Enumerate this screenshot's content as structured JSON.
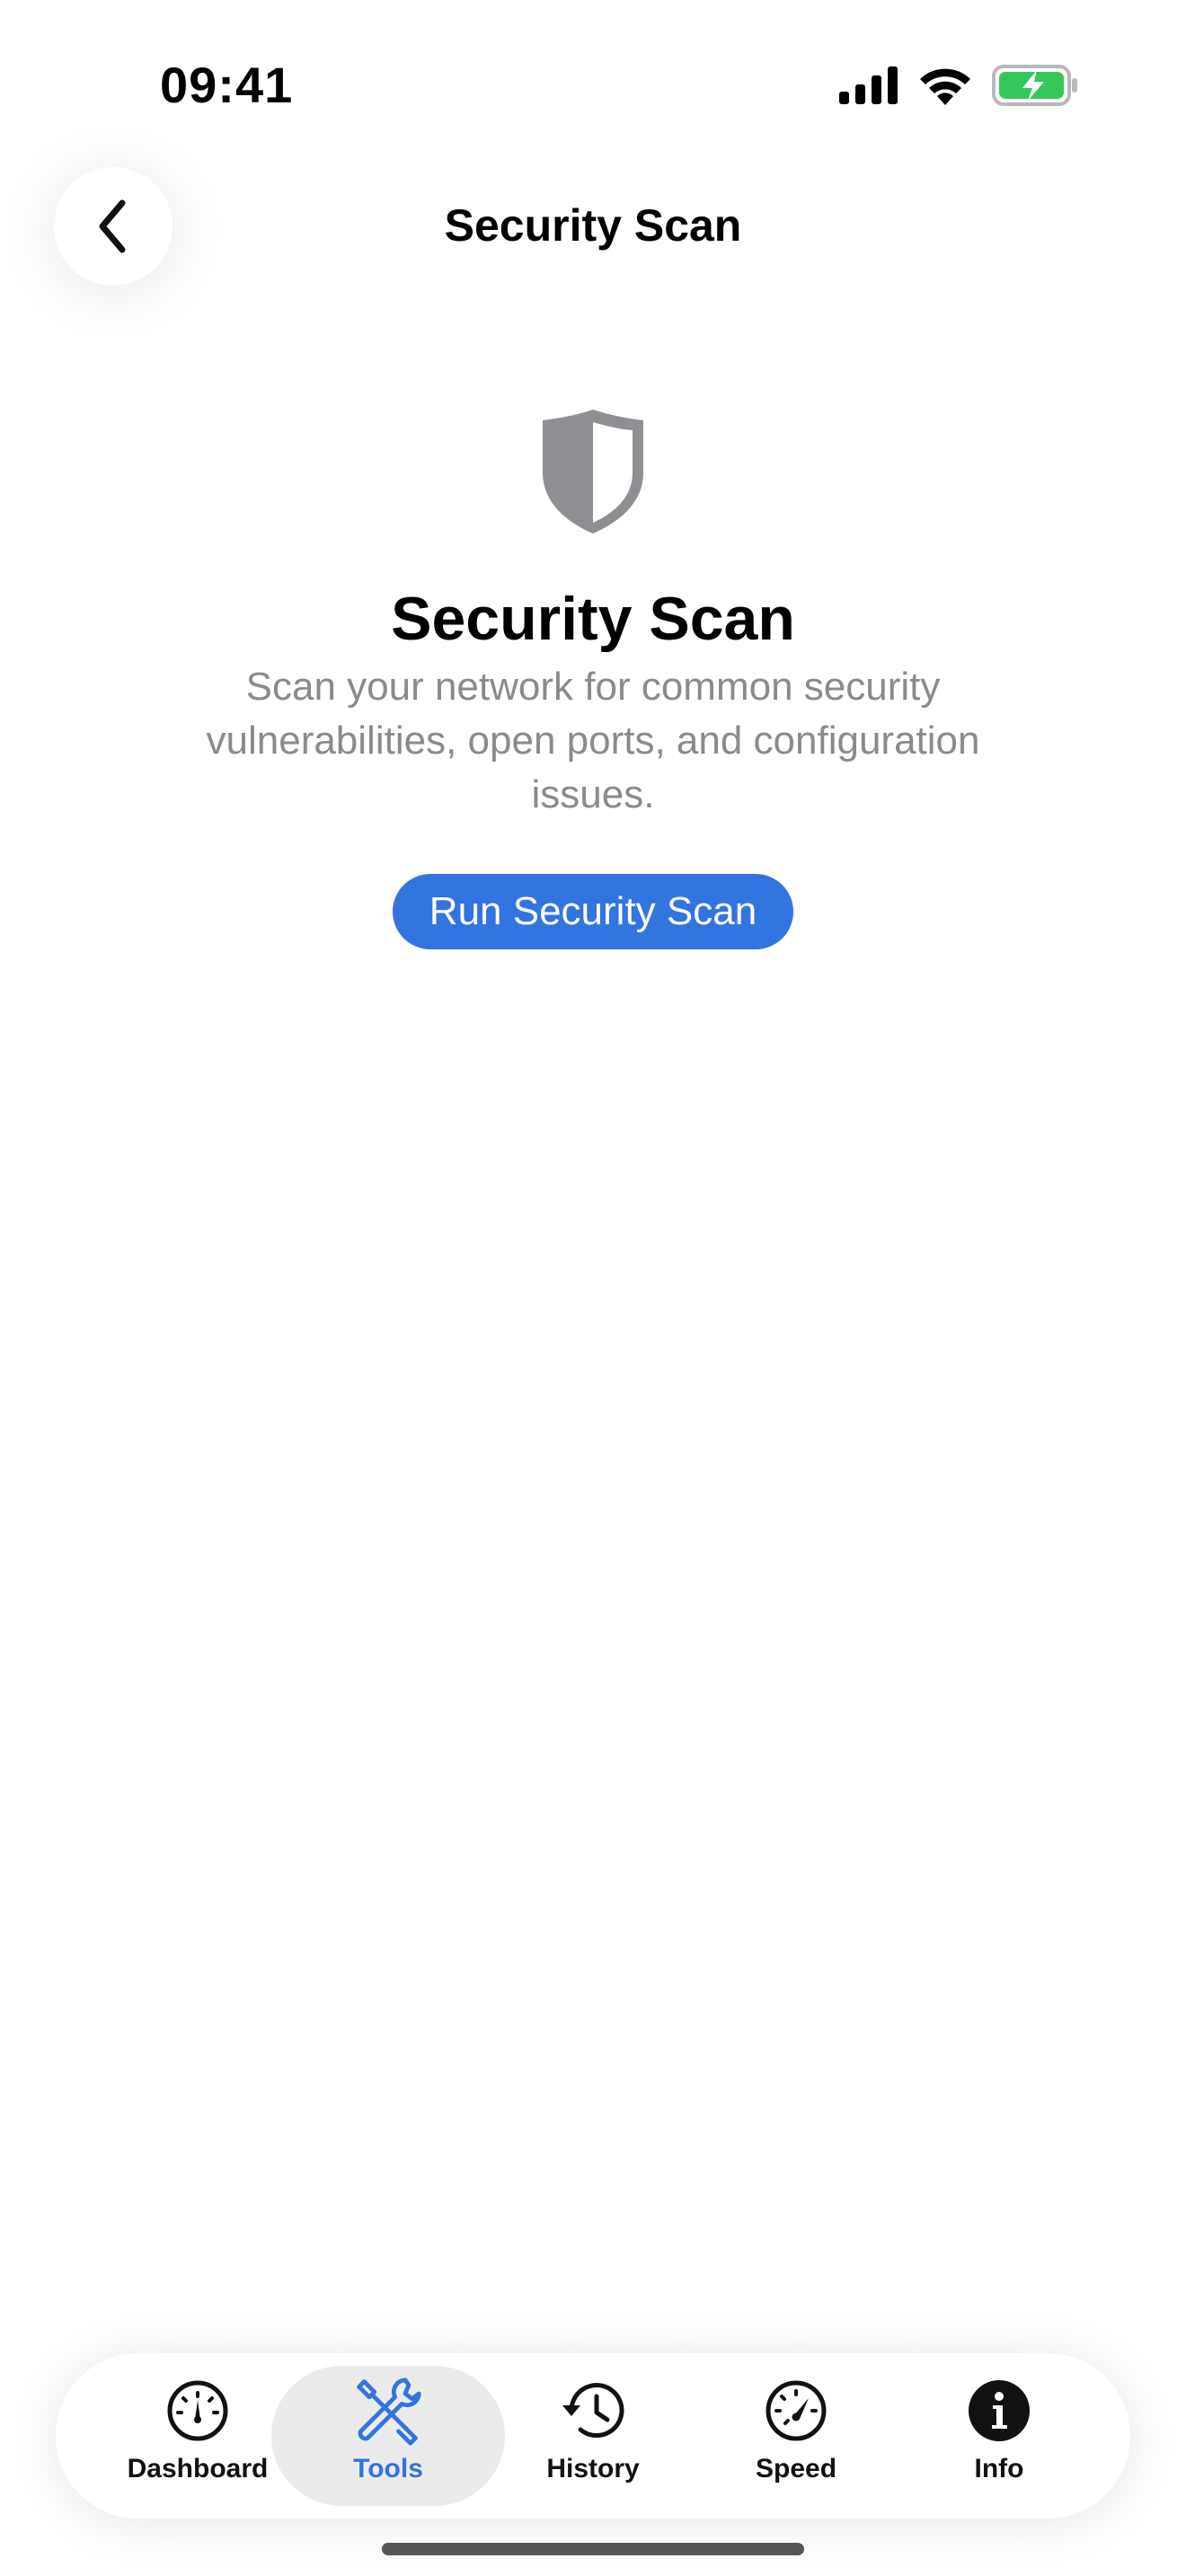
{
  "status_bar": {
    "time": "09:41",
    "icons": [
      "cellular-signal-icon",
      "wifi-icon",
      "battery-charging-icon"
    ],
    "battery_color": "#34c759"
  },
  "nav": {
    "title": "Security Scan",
    "back_icon": "chevron-left-icon"
  },
  "main": {
    "icon": "shield-icon",
    "icon_color": "#8e8e93",
    "title": "Security Scan",
    "description": "Scan your network for common security vulnerabilities, open ports, and configuration issues.",
    "button_label": "Run Security Scan",
    "accent_color": "#3274e0"
  },
  "tabbar": {
    "tabs": [
      {
        "label": "Dashboard",
        "icon": "gauge-icon"
      },
      {
        "label": "Tools",
        "icon": "tools-icon",
        "active": true
      },
      {
        "label": "History",
        "icon": "clock-history-icon"
      },
      {
        "label": "Speed",
        "icon": "speedometer-icon"
      },
      {
        "label": "Info",
        "icon": "info-icon"
      }
    ]
  }
}
